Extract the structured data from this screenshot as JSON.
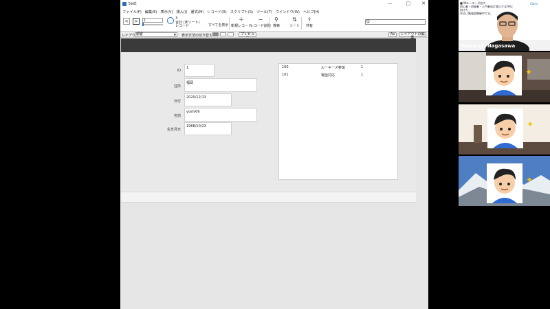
{
  "window": {
    "title": "test",
    "min": "—",
    "max": "□",
    "close": "✕"
  },
  "menu": [
    "ファイル(F)",
    "編集(E)",
    "表示(V)",
    "挿入(I)",
    "書式(M)",
    "レコード(R)",
    "スクリプト(S)",
    "ツール(T)",
    "ウインドウ(W)",
    "ヘルプ(H)"
  ],
  "toolbar": {
    "back_icon": "<",
    "forward_icon": ">",
    "record_value": "1",
    "found_count": "3",
    "total_label": "合計 (未ソート)",
    "record_label": "レコード",
    "show_all": "すべてを表示",
    "new_record": "新規レコード",
    "delete_record": "レコード削除",
    "find": "検索",
    "sort": "ソート",
    "share": "共有",
    "search_glyph": "Q",
    "new_record_icon": "＋",
    "delete_record_icon": "−",
    "find_icon": "⚲",
    "sort_icon": "⇅",
    "share_icon": "⇪"
  },
  "layoutbar": {
    "layout_label": "レイアウト:",
    "layout_value": "顧客",
    "view_as_label": "表示方法の切り替え:",
    "preview": "プレビュー",
    "aa": "Aa",
    "edit_layout": "レイアウトの編集",
    "dropdown_arrow": "▼"
  },
  "form": {
    "fields": [
      {
        "label": "ID",
        "value": "1"
      },
      {
        "label": "住所",
        "value": "福岡"
      },
      {
        "label": "日付",
        "value": "2020/12/13"
      },
      {
        "label": "名前",
        "value": "yoshi06"
      },
      {
        "label": "生年月日",
        "value": "1968/10/23"
      }
    ],
    "portal_rows": [
      {
        "code": "100",
        "name": "ルーキーズ参加",
        "qty": "1"
      },
      {
        "code": "101",
        "name": "電話対応",
        "qty": "1"
      }
    ]
  },
  "participants": {
    "host": {
      "name": "Yoshiyuki Nagasawa",
      "banner_line1": "■FMルーキーズ訪ス",
      "banner_line2": "初心者・初級者・入門者向け超小さなFMに向けた",
      "banner_line3": "ゆるい勉強会開催中です。",
      "logo": "Claris"
    }
  },
  "colors": {
    "accent": "#2a6fb4",
    "header_band": "#3a3a3a"
  }
}
